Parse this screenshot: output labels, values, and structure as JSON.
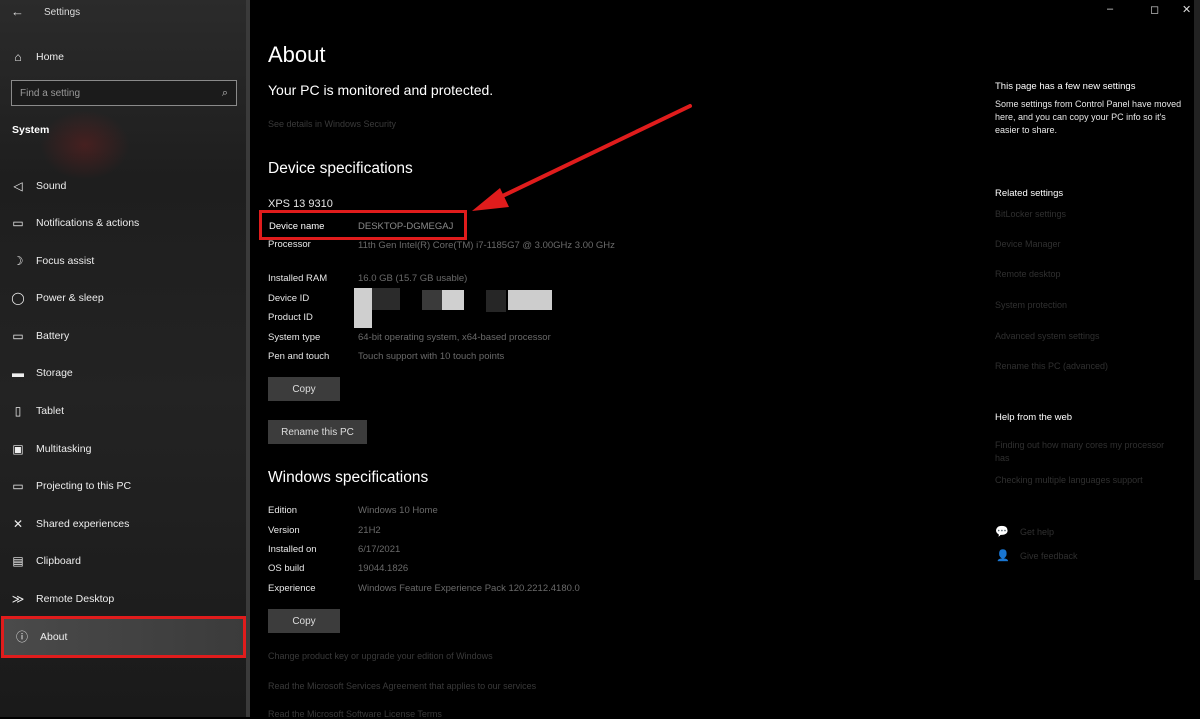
{
  "window": {
    "title": "Settings",
    "back_glyph": "←",
    "controls": {
      "minimize": "–",
      "maximize": "◻",
      "close": "✕"
    }
  },
  "sidebar": {
    "home": {
      "label": "Home",
      "icon": "home-icon",
      "glyph": "⌂"
    },
    "search_placeholder": "Find a setting",
    "section_title": "System",
    "items": [
      {
        "label": "Sound",
        "icon": "speaker-icon",
        "glyph": "🔈"
      },
      {
        "label": "Notifications & actions",
        "icon": "notification-icon",
        "glyph": "▭"
      },
      {
        "label": "Focus assist",
        "icon": "moon-icon",
        "glyph": "☽"
      },
      {
        "label": "Power & sleep",
        "icon": "power-icon",
        "glyph": "⏻"
      },
      {
        "label": "Battery",
        "icon": "battery-icon",
        "glyph": "▭"
      },
      {
        "label": "Storage",
        "icon": "storage-icon",
        "glyph": "▬"
      },
      {
        "label": "Tablet",
        "icon": "tablet-icon",
        "glyph": "▯"
      },
      {
        "label": "Multitasking",
        "icon": "multitasking-icon",
        "glyph": "⧉"
      },
      {
        "label": "Projecting to this PC",
        "icon": "projecting-icon",
        "glyph": "▭"
      },
      {
        "label": "Shared experiences",
        "icon": "shared-icon",
        "glyph": "✕"
      },
      {
        "label": "Clipboard",
        "icon": "clipboard-icon",
        "glyph": "📋"
      },
      {
        "label": "Remote Desktop",
        "icon": "remote-desktop-icon",
        "glyph": "≫"
      },
      {
        "label": "About",
        "icon": "info-icon",
        "glyph": "ⓘ"
      }
    ]
  },
  "main": {
    "title": "About",
    "protection_status": "Your PC is monitored and protected.",
    "security_link": "See details in Windows Security",
    "device_specs_heading": "Device specifications",
    "device_model": "XPS 13 9310",
    "device_specs": [
      {
        "key": "Device name",
        "value": "DESKTOP-DGMEGAJ"
      },
      {
        "key": "Processor",
        "value": "11th Gen Intel(R) Core(TM) i7-1185G7 @ 3.00GHz   3.00 GHz"
      },
      {
        "key": "Installed RAM",
        "value": "16.0 GB (15.7 GB usable)"
      },
      {
        "key": "Device ID",
        "value": ""
      },
      {
        "key": "Product ID",
        "value": ""
      },
      {
        "key": "System type",
        "value": "64-bit operating system, x64-based processor"
      },
      {
        "key": "Pen and touch",
        "value": "Touch support with 10 touch points"
      }
    ],
    "copy_button": "Copy",
    "rename_button": "Rename this PC",
    "windows_specs_heading": "Windows specifications",
    "windows_specs": [
      {
        "key": "Edition",
        "value": "Windows 10 Home"
      },
      {
        "key": "Version",
        "value": "21H2"
      },
      {
        "key": "Installed on",
        "value": "6/17/2021"
      },
      {
        "key": "OS build",
        "value": "19044.1826"
      },
      {
        "key": "Experience",
        "value": "Windows Feature Experience Pack 120.2212.4180.0"
      }
    ],
    "copy_button_2": "Copy",
    "bottom_links": [
      "Change product key or upgrade your edition of Windows",
      "Read the Microsoft Services Agreement that applies to our services",
      "Read the Microsoft Software License Terms"
    ]
  },
  "right_panel": {
    "new_settings_heading": "This page has a few new settings",
    "new_settings_text": "Some settings from Control Panel have moved here, and you can copy your PC info so it's easier to share.",
    "related_heading": "Related settings",
    "related_links": [
      "BitLocker settings",
      "Device Manager",
      "Remote desktop",
      "System protection",
      "Advanced system settings",
      "Rename this PC (advanced)"
    ],
    "help_heading": "Help from the web",
    "help_links": [
      "Finding out how many cores my processor has",
      "Checking multiple languages support"
    ],
    "get_help": "Get help",
    "give_feedback": "Give feedback"
  },
  "colors": {
    "highlight_red": "#e01c1c",
    "background": "#000000",
    "sidebar_bg": "#232323"
  }
}
